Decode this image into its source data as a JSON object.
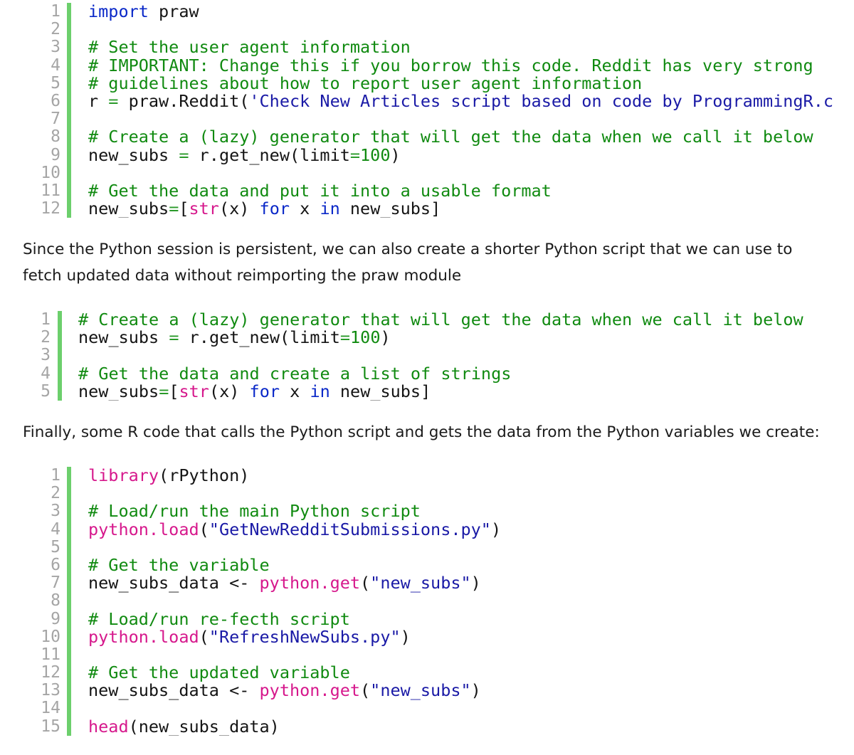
{
  "block1": {
    "line_numbers": [
      "1",
      "2",
      "3",
      "4",
      "5",
      "6",
      "7",
      "8",
      "9",
      "10",
      "11",
      "12"
    ],
    "lines": [
      [
        {
          "t": "import",
          "c": "kw"
        },
        {
          "t": " praw",
          "c": ""
        }
      ],
      [],
      [
        {
          "t": "# Set the user agent information",
          "c": "cmt"
        }
      ],
      [
        {
          "t": "# IMPORTANT: Change this if you borrow this code. Reddit has very strong",
          "c": "cmt"
        }
      ],
      [
        {
          "t": "# guidelines about how to report user agent information",
          "c": "cmt"
        }
      ],
      [
        {
          "t": "r ",
          "c": ""
        },
        {
          "t": "=",
          "c": "op"
        },
        {
          "t": " praw.Reddit(",
          "c": ""
        },
        {
          "t": "'Check New Articles script based on code by ProgrammingR.c",
          "c": "str"
        }
      ],
      [],
      [
        {
          "t": "# Create a (lazy) generator that will get the data when we call it below",
          "c": "cmt"
        }
      ],
      [
        {
          "t": "new_subs ",
          "c": ""
        },
        {
          "t": "=",
          "c": "op"
        },
        {
          "t": " r.get_new(limit",
          "c": ""
        },
        {
          "t": "=",
          "c": "op"
        },
        {
          "t": "100",
          "c": "num"
        },
        {
          "t": ")",
          "c": ""
        }
      ],
      [],
      [
        {
          "t": "# Get the data and put it into a usable format",
          "c": "cmt"
        }
      ],
      [
        {
          "t": "new_subs",
          "c": ""
        },
        {
          "t": "=",
          "c": "op"
        },
        {
          "t": "[",
          "c": ""
        },
        {
          "t": "str",
          "c": "bi"
        },
        {
          "t": "(x) ",
          "c": ""
        },
        {
          "t": "for",
          "c": "kw"
        },
        {
          "t": " x ",
          "c": ""
        },
        {
          "t": "in",
          "c": "kw"
        },
        {
          "t": " new_subs]",
          "c": ""
        }
      ]
    ]
  },
  "para1": "Since the Python session is persistent, we can also create a shorter Python script that we can use to fetch updated data without reimporting the praw module",
  "block2": {
    "line_numbers": [
      "1",
      "2",
      "3",
      "4",
      "5"
    ],
    "lines": [
      [
        {
          "t": "# Create a (lazy) generator that will get the data when we call it below",
          "c": "cmt"
        }
      ],
      [
        {
          "t": "new_subs ",
          "c": ""
        },
        {
          "t": "=",
          "c": "op"
        },
        {
          "t": " r.get_new(limit",
          "c": ""
        },
        {
          "t": "=",
          "c": "op"
        },
        {
          "t": "100",
          "c": "num"
        },
        {
          "t": ")",
          "c": ""
        }
      ],
      [],
      [
        {
          "t": "# Get the data and create a list of strings",
          "c": "cmt"
        }
      ],
      [
        {
          "t": "new_subs",
          "c": ""
        },
        {
          "t": "=",
          "c": "op"
        },
        {
          "t": "[",
          "c": ""
        },
        {
          "t": "str",
          "c": "bi"
        },
        {
          "t": "(x) ",
          "c": ""
        },
        {
          "t": "for",
          "c": "kw"
        },
        {
          "t": " x ",
          "c": ""
        },
        {
          "t": "in",
          "c": "kw"
        },
        {
          "t": " new_subs]",
          "c": ""
        }
      ]
    ]
  },
  "para2": "Finally, some R code that calls the Python script and gets the data from the Python variables we create:",
  "block3": {
    "line_numbers": [
      "1",
      "2",
      "3",
      "4",
      "5",
      "6",
      "7",
      "8",
      "9",
      "10",
      "11",
      "12",
      "13",
      "14",
      "15"
    ],
    "lines": [
      [
        {
          "t": "library",
          "c": "bi"
        },
        {
          "t": "(rPython)",
          "c": ""
        }
      ],
      [],
      [
        {
          "t": "# Load/run the main Python script",
          "c": "cmt"
        }
      ],
      [
        {
          "t": "python.load",
          "c": "bi"
        },
        {
          "t": "(",
          "c": ""
        },
        {
          "t": "\"GetNewRedditSubmissions.py\"",
          "c": "str"
        },
        {
          "t": ")",
          "c": ""
        }
      ],
      [],
      [
        {
          "t": "# Get the variable",
          "c": "cmt"
        }
      ],
      [
        {
          "t": "new_subs_data <- ",
          "c": ""
        },
        {
          "t": "python.get",
          "c": "bi"
        },
        {
          "t": "(",
          "c": ""
        },
        {
          "t": "\"new_subs\"",
          "c": "str"
        },
        {
          "t": ")",
          "c": ""
        }
      ],
      [],
      [
        {
          "t": "# Load/run re-fecth script",
          "c": "cmt"
        }
      ],
      [
        {
          "t": "python.load",
          "c": "bi"
        },
        {
          "t": "(",
          "c": ""
        },
        {
          "t": "\"RefreshNewSubs.py\"",
          "c": "str"
        },
        {
          "t": ")",
          "c": ""
        }
      ],
      [],
      [
        {
          "t": "# Get the updated variable",
          "c": "cmt"
        }
      ],
      [
        {
          "t": "new_subs_data <- ",
          "c": ""
        },
        {
          "t": "python.get",
          "c": "bi"
        },
        {
          "t": "(",
          "c": ""
        },
        {
          "t": "\"new_subs\"",
          "c": "str"
        },
        {
          "t": ")",
          "c": ""
        }
      ],
      [],
      [
        {
          "t": "head",
          "c": "bi"
        },
        {
          "t": "(new_subs_data)",
          "c": ""
        }
      ]
    ]
  }
}
